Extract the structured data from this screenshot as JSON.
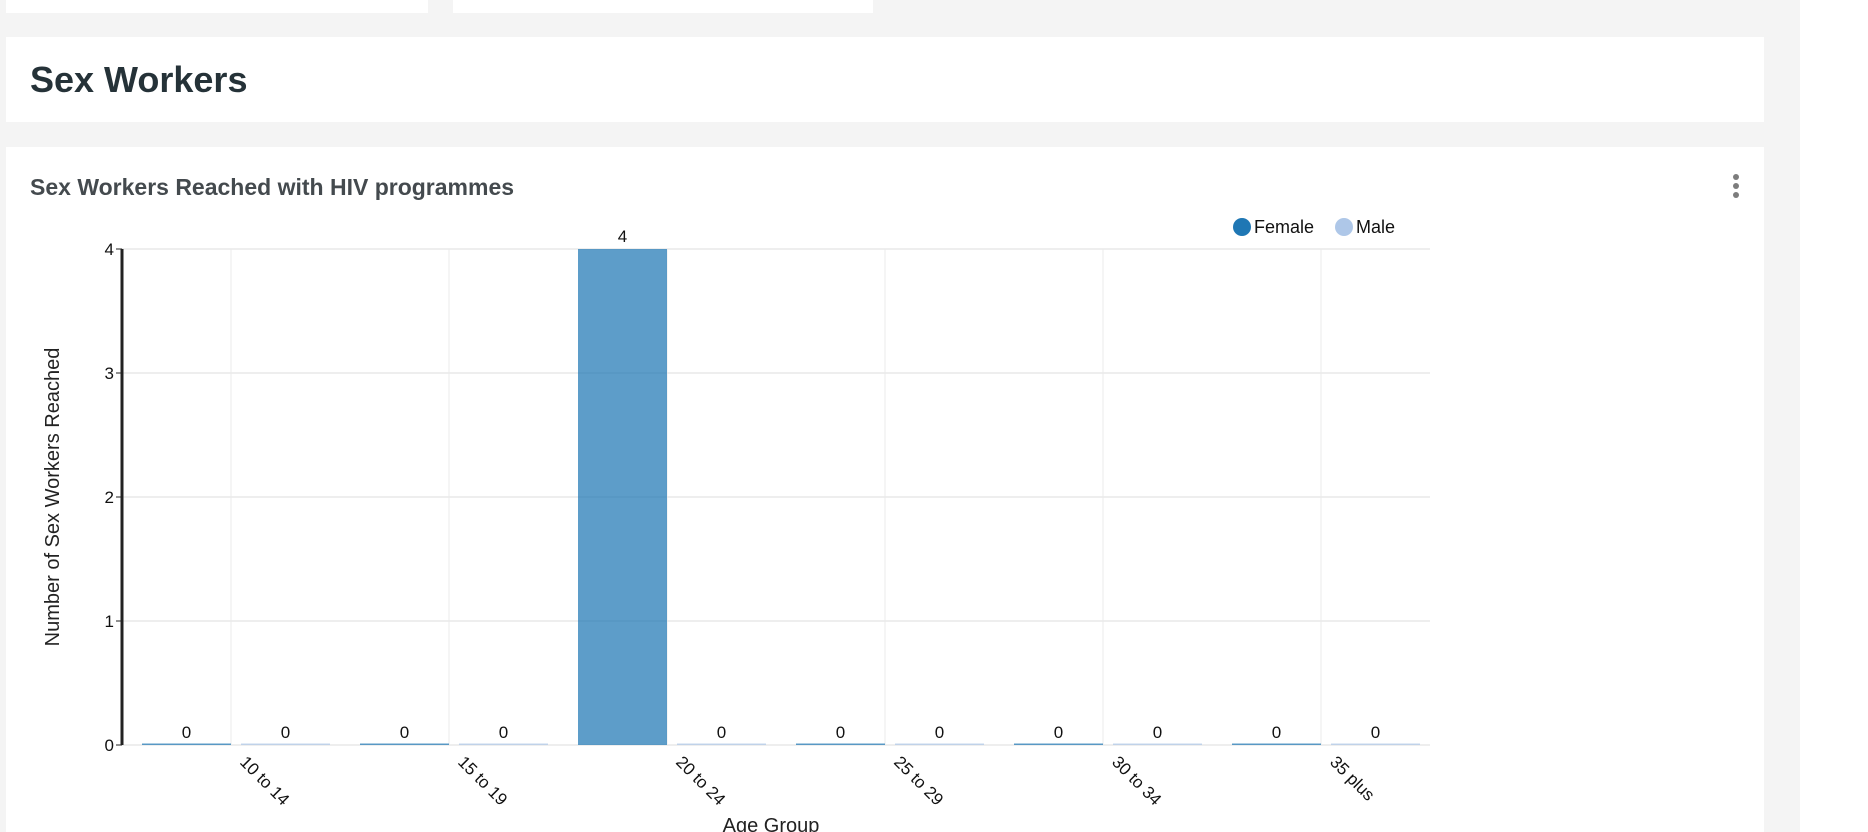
{
  "section": {
    "title": "Sex Workers"
  },
  "card": {
    "title": "Sex Workers Reached with HIV programmes",
    "menu_icon": "kebab-menu-icon"
  },
  "colors": {
    "female": "#1f77b4",
    "male": "#aec7e8",
    "grid": "#dcdcdc",
    "axis": "#222222"
  },
  "chart_data": {
    "type": "bar",
    "title": "Sex Workers Reached with HIV programmes",
    "categories": [
      "10 to 14",
      "15 to 19",
      "20 to 24",
      "25 to 29",
      "30 to 34",
      "35 plus"
    ],
    "series": [
      {
        "name": "Female",
        "values": [
          0,
          0,
          4,
          0,
          0,
          0
        ]
      },
      {
        "name": "Male",
        "values": [
          0,
          0,
          0,
          0,
          0,
          0
        ]
      }
    ],
    "xlabel": "Age Group",
    "ylabel": "Number of Sex Workers Reached",
    "ylim": [
      0,
      4
    ],
    "yticks": [
      0,
      1,
      2,
      3,
      4
    ],
    "grid": true,
    "legend_position": "top-right",
    "data_labels": true
  }
}
